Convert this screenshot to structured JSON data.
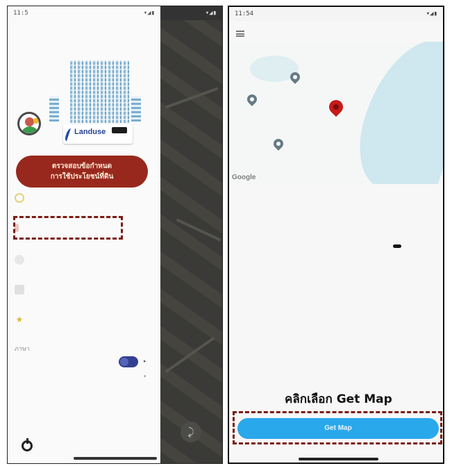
{
  "left_screen": {
    "status": {
      "time": "11:5",
      "icons": "▾◢▮"
    },
    "drawer": {
      "logo_text": "Landuse",
      "main_button_line1": "ตรวจสอบข้อกำหนด",
      "main_button_line2": "การใช้ประโยชน์ที่ดิน",
      "toggle_label": "ภาษา",
      "menu_items": [
        {
          "icon": "refresh-icon"
        },
        {
          "icon": "map-pin-icon",
          "highlighted": true
        },
        {
          "icon": "location-icon"
        },
        {
          "icon": "document-icon"
        },
        {
          "icon": "star-icon"
        },
        {
          "icon": "settings-icon"
        }
      ]
    }
  },
  "right_screen": {
    "status": {
      "time": "11:54",
      "icons": "▾◢▮"
    },
    "map": {
      "google_label": "Google",
      "labels": [
        "",
        "",
        ""
      ]
    },
    "caption": "คลิกเลือก Get Map",
    "get_map_label": "Get Map"
  },
  "colors": {
    "primary_button": "#98281d",
    "get_map_button": "#2aa8ec",
    "highlight_outline": "#7a1b12",
    "selected_pin": "#c61a1a"
  }
}
